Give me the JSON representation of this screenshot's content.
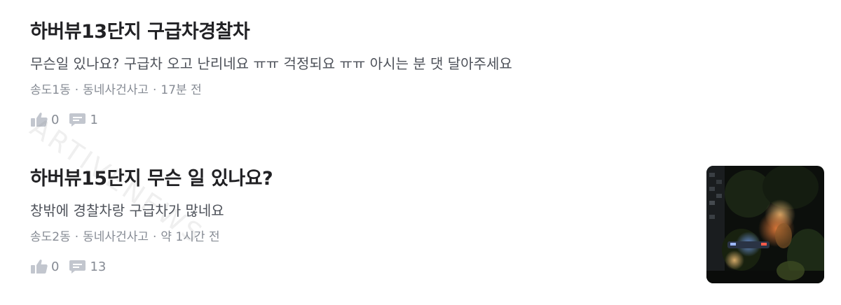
{
  "posts": [
    {
      "title": "하버뷰13단지 구급차경찰차",
      "body": "무슨일 있나요? 구급차 오고 난리네요 ㅠㅠ 걱정되요 ㅠㅠ 아시는 분 댓 달아주세요",
      "location": "송도1동",
      "category": "동네사건사고",
      "time": "17분 전",
      "likes": "0",
      "comments": "1",
      "has_image": false
    },
    {
      "title": "하버뷰15단지 무슨 일 있나요?",
      "body": "창밖에 경찰차랑 구급차가 많네요",
      "location": "송도2동",
      "category": "동네사건사고",
      "time": "약 1시간 전",
      "likes": "0",
      "comments": "13",
      "has_image": true
    }
  ],
  "separator": "·",
  "watermark": "ARTIVENEWS",
  "icons": {
    "like": "thumbs-up-icon",
    "comment": "comment-icon"
  },
  "colors": {
    "title": "#212124",
    "body": "#4d5159",
    "meta": "#868b94",
    "icon": "#c2c6ce"
  }
}
